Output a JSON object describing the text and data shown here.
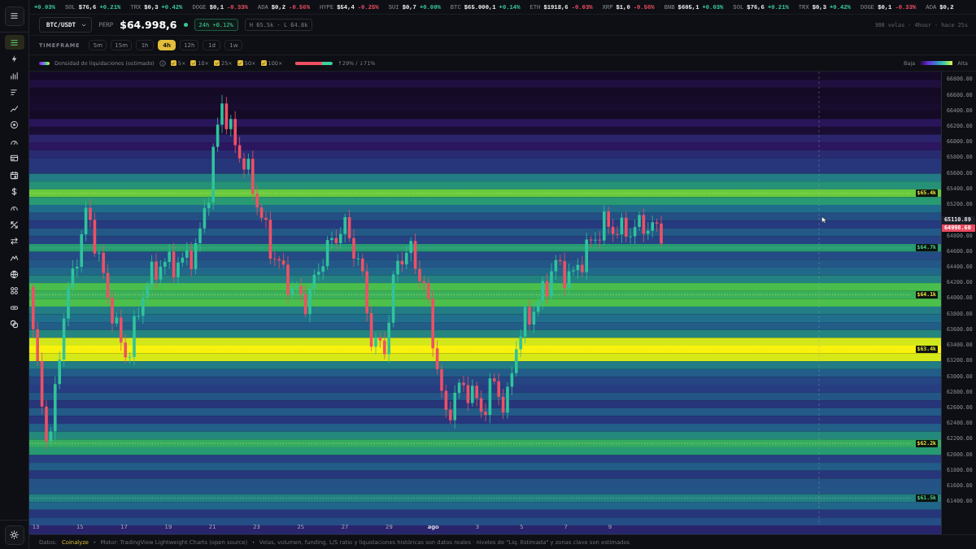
{
  "sidebar": {
    "items": [
      {
        "selected": true
      },
      {
        "selected": false
      },
      {
        "selected": false
      },
      {
        "selected": false
      },
      {
        "selected": false
      },
      {
        "selected": false
      },
      {
        "selected": false
      },
      {
        "selected": false
      },
      {
        "selected": false
      },
      {
        "selected": false
      },
      {
        "selected": false
      },
      {
        "selected": false
      },
      {
        "selected": false
      },
      {
        "selected": false
      },
      {
        "selected": false
      },
      {
        "selected": false
      },
      {
        "selected": false
      },
      {
        "selected": false
      }
    ]
  },
  "ticker": [
    {
      "change": "+0.03%",
      "rising": true
    },
    {
      "symbol": "SOL",
      "price": "$76,6",
      "change": "+0.21%",
      "rising": true
    },
    {
      "symbol": "TRX",
      "price": "$0,3",
      "change": "+0.42%",
      "rising": true
    },
    {
      "symbol": "DOGE",
      "price": "$0,1",
      "change": "-0.33%",
      "rising": false
    },
    {
      "symbol": "ADA",
      "price": "$0,2",
      "change": "-0.56%",
      "rising": false
    },
    {
      "symbol": "HYPE",
      "price": "$54,4",
      "change": "-0.25%",
      "rising": false
    },
    {
      "symbol": "SUI",
      "price": "$0,7",
      "change": "+0.00%",
      "rising": true
    },
    {
      "symbol": "BTC",
      "price": "$65.000,1",
      "change": "+0.14%",
      "rising": true
    },
    {
      "symbol": "ETH",
      "price": "$1918,6",
      "change": "-0.03%",
      "rising": false
    },
    {
      "symbol": "XRP",
      "price": "$1,0",
      "change": "-0.56%",
      "rising": false
    },
    {
      "symbol": "BNB",
      "price": "$605,1",
      "change": "+0.03%",
      "rising": true
    },
    {
      "symbol": "SOL",
      "price": "$76,6",
      "change": "+0.21%",
      "rising": true
    },
    {
      "symbol": "TRX",
      "price": "$0,3",
      "change": "+0.42%",
      "rising": true
    },
    {
      "symbol": "DOGE",
      "price": "$0,1",
      "change": "-0.33%",
      "rising": false
    },
    {
      "symbol": "ADA",
      "price": "$0,2"
    }
  ],
  "header": {
    "pair": "BTC/USDT",
    "market": "PERP",
    "price": "$64.998,6",
    "change_24h": "24h +0.12%",
    "range": "H 65.5k · L 64.8k",
    "meta": "300 velas · 4hour · hace 25s"
  },
  "timeframe": {
    "label": "TIMEFRAME",
    "options": [
      {
        "label": "5m",
        "selected": false
      },
      {
        "label": "15m",
        "selected": false
      },
      {
        "label": "1h",
        "selected": false
      },
      {
        "label": "4h",
        "selected": true
      },
      {
        "label": "12h",
        "selected": false
      },
      {
        "label": "1d",
        "selected": false
      },
      {
        "label": "1w",
        "selected": false
      }
    ]
  },
  "legend": {
    "title": "Densidad de liquidaciones (estimado)",
    "leverages": [
      {
        "label": "5×",
        "checked": true
      },
      {
        "label": "10×",
        "checked": true
      },
      {
        "label": "25×",
        "checked": true
      },
      {
        "label": "50×",
        "checked": true
      },
      {
        "label": "100×",
        "checked": true
      }
    ],
    "ratio": {
      "level": 0.71,
      "label": "↑29% / ↓71%"
    },
    "scale_low": "Baja",
    "scale_high": "Alta"
  },
  "chart": {
    "price_ticks": [
      "66800.00",
      "66600.00",
      "66400.00",
      "66200.00",
      "66000.00",
      "65800.00",
      "65600.00",
      "65400.00",
      "65200.00",
      "64800.00",
      "64600.00",
      "64400.00",
      "64200.00",
      "64000.00",
      "63800.00",
      "63600.00",
      "63400.00",
      "63200.00",
      "63000.00",
      "62800.00",
      "62600.00",
      "62400.00",
      "62200.00",
      "62000.00",
      "61800.00",
      "61600.00",
      "61400.00"
    ],
    "price_marks": [
      {
        "label": "65110.89",
        "kind": "last"
      },
      {
        "label": "64998.60",
        "kind": "current"
      }
    ],
    "levels": [
      {
        "label": "$65.4k",
        "major": true
      },
      {
        "label": "$64.7k",
        "major": false
      },
      {
        "label": "$64.1k",
        "major": true
      },
      {
        "label": "$63.4k",
        "major": true
      },
      {
        "label": "$62.2k",
        "major": true
      },
      {
        "label": "$61.5k",
        "major": false
      }
    ],
    "dates": [
      {
        "label": "13",
        "month": false
      },
      {
        "label": "15",
        "month": false
      },
      {
        "label": "17",
        "month": false
      },
      {
        "label": "19",
        "month": false
      },
      {
        "label": "21",
        "month": false
      },
      {
        "label": "23",
        "month": false
      },
      {
        "label": "25",
        "month": false
      },
      {
        "label": "27",
        "month": false
      },
      {
        "label": "29",
        "month": false
      },
      {
        "label": "ago",
        "month": true
      },
      {
        "label": "3",
        "month": false
      },
      {
        "label": "5",
        "month": false
      },
      {
        "label": "7",
        "month": false
      },
      {
        "label": "9",
        "month": false
      }
    ]
  },
  "footer": [
    {
      "kind": "text",
      "text": "Datos:"
    },
    {
      "kind": "link",
      "text": "Coinalyze"
    },
    {
      "kind": "separator",
      "text": "·"
    },
    {
      "kind": "text",
      "text": "Motor: TradingView Lightweight Charts (open source)"
    },
    {
      "kind": "separator",
      "text": "·"
    },
    {
      "kind": "text",
      "text": "Velas, volumen, funding, L/S ratio y liquidaciones históricas son datos reales · niveles de \"Liq. Estimada\" y zonas clave son estimados"
    }
  ]
}
